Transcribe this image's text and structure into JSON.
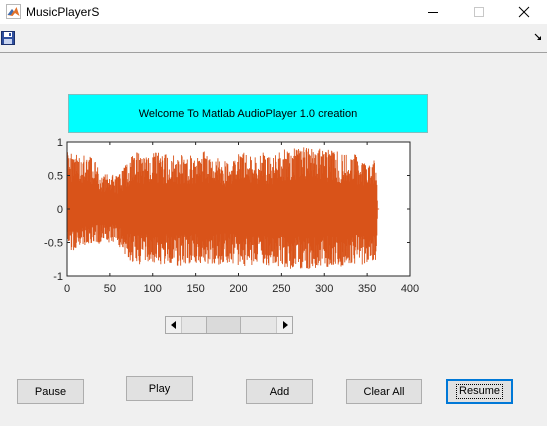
{
  "window": {
    "title": "MusicPlayerS",
    "app_icon": "matlab-icon",
    "controls": [
      "minimize-icon",
      "maximize-icon",
      "close-icon"
    ]
  },
  "toolbar": {
    "save_icon": "save-icon",
    "dock_icon": "dock-arrow-icon"
  },
  "banner": {
    "text": "Welcome To Matlab AudioPlayer 1.0 creation",
    "background": "#00ffff"
  },
  "slider": {
    "value_fraction": 0.4
  },
  "buttons": {
    "pause": "Pause",
    "play": "Play",
    "add": "Add",
    "clear_all": "Clear All",
    "resume": "Resume"
  },
  "chart_data": {
    "type": "line",
    "title": "",
    "xlabel": "",
    "ylabel": "",
    "xlim": [
      0,
      400
    ],
    "ylim": [
      -1,
      1
    ],
    "x_ticks": [
      0,
      50,
      100,
      150,
      200,
      250,
      300,
      350,
      400
    ],
    "y_ticks": [
      -1,
      -0.5,
      0,
      0.5,
      1
    ],
    "x_tick_labels": [
      "0",
      "50",
      "100",
      "150",
      "200",
      "250",
      "300",
      "350",
      "400"
    ],
    "y_tick_labels": [
      "-1",
      "-0.5",
      "0",
      "0.5",
      "1"
    ],
    "grid": false,
    "series": [
      {
        "signal_end_x": 362,
        "color": "#d95319",
        "envelope": {
          "x": [
            0,
            10,
            20,
            30,
            40,
            50,
            60,
            70,
            80,
            90,
            100,
            110,
            120,
            130,
            140,
            150,
            160,
            170,
            180,
            190,
            200,
            210,
            220,
            230,
            240,
            250,
            260,
            270,
            280,
            290,
            300,
            310,
            320,
            330,
            340,
            350,
            355,
            360,
            362
          ],
          "upper": [
            0.88,
            0.82,
            0.8,
            0.78,
            0.55,
            0.52,
            0.5,
            0.7,
            0.86,
            0.82,
            0.84,
            0.86,
            0.8,
            0.83,
            0.84,
            0.76,
            0.86,
            0.85,
            0.7,
            0.76,
            0.84,
            0.86,
            0.82,
            0.85,
            0.78,
            0.88,
            0.92,
            0.9,
            0.94,
            0.92,
            0.88,
            0.9,
            0.84,
            0.86,
            0.8,
            0.7,
            0.78,
            0.72,
            0.2
          ],
          "lower": [
            -0.68,
            -0.62,
            -0.58,
            -0.52,
            -0.52,
            -0.5,
            -0.54,
            -0.72,
            -0.86,
            -0.84,
            -0.8,
            -0.84,
            -0.82,
            -0.86,
            -0.82,
            -0.8,
            -0.84,
            -0.86,
            -0.82,
            -0.8,
            -0.84,
            -0.86,
            -0.82,
            -0.84,
            -0.86,
            -0.86,
            -0.9,
            -0.88,
            -0.92,
            -0.9,
            -0.88,
            -0.9,
            -0.86,
            -0.84,
            -0.84,
            -0.82,
            -0.82,
            -0.8,
            -0.2
          ]
        }
      }
    ]
  }
}
